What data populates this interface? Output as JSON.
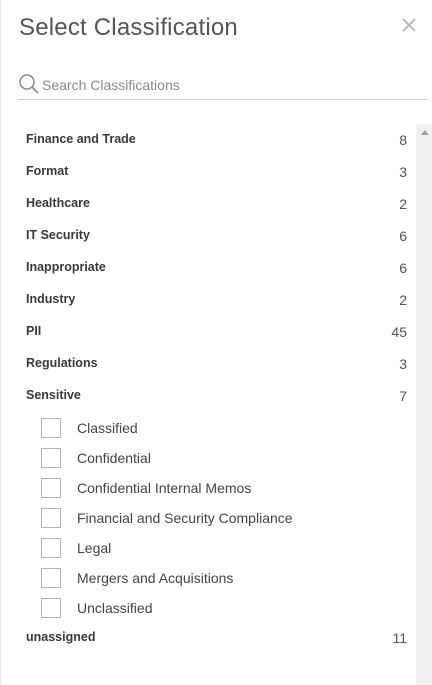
{
  "title": "Select Classification",
  "search": {
    "placeholder": "Search Classifications",
    "value": ""
  },
  "categories": [
    {
      "name": "Finance and Trade",
      "count": "8"
    },
    {
      "name": "Format",
      "count": "3"
    },
    {
      "name": "Healthcare",
      "count": "2"
    },
    {
      "name": "IT Security",
      "count": "6"
    },
    {
      "name": "Inappropriate",
      "count": "6"
    },
    {
      "name": "Industry",
      "count": "2"
    },
    {
      "name": "PII",
      "count": "45"
    },
    {
      "name": "Regulations",
      "count": "3"
    },
    {
      "name": "Sensitive",
      "count": "7"
    }
  ],
  "sensitive_items": [
    {
      "label": "Classified",
      "checked": false
    },
    {
      "label": "Confidential",
      "checked": false
    },
    {
      "label": "Confidential Internal Memos",
      "checked": false
    },
    {
      "label": "Financial and Security Compliance",
      "checked": false
    },
    {
      "label": "Legal",
      "checked": false
    },
    {
      "label": "Mergers and Acquisitions",
      "checked": false
    },
    {
      "label": "Unclassified",
      "checked": false
    }
  ],
  "unassigned": {
    "name": "unassigned",
    "count": "11"
  }
}
